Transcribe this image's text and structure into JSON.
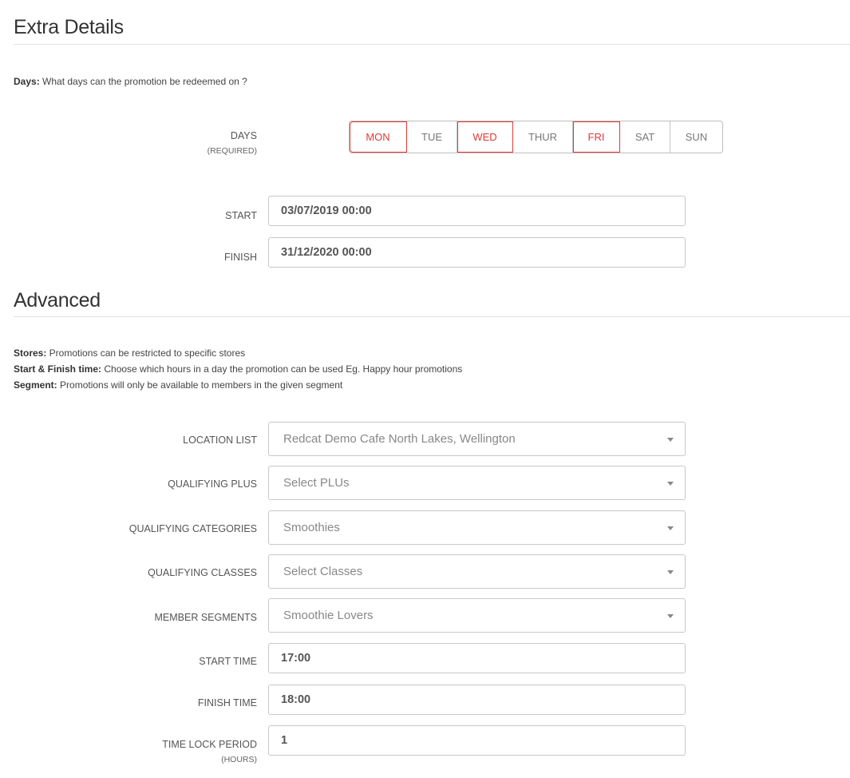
{
  "extra": {
    "title": "Extra Details",
    "help_key": "Days:",
    "help_text": " What days can the promotion be redeemed on ?",
    "days_label": "DAYS",
    "days_required": "(REQUIRED)",
    "days": [
      {
        "label": "MON",
        "selected": true
      },
      {
        "label": "TUE",
        "selected": false
      },
      {
        "label": "WED",
        "selected": true
      },
      {
        "label": "THUR",
        "selected": false
      },
      {
        "label": "FRI",
        "selected": true
      },
      {
        "label": "SAT",
        "selected": false
      },
      {
        "label": "SUN",
        "selected": false
      }
    ],
    "start_label": "START",
    "start_value": "03/07/2019 00:00",
    "finish_label": "FINISH",
    "finish_value": "31/12/2020 00:00"
  },
  "advanced": {
    "title": "Advanced",
    "help": [
      {
        "key": "Stores:",
        "text": " Promotions can be restricted to specific stores"
      },
      {
        "key": "Start & Finish time:",
        "text": " Choose which hours in a day the promotion can be used Eg. Happy hour promotions"
      },
      {
        "key": "Segment:",
        "text": " Promotions will only be available to members in the given segment"
      }
    ],
    "location_label": "LOCATION LIST",
    "location_value": "Redcat Demo Cafe North Lakes, Wellington",
    "plus_label": "QUALIFYING PLUS",
    "plus_value": "Select PLUs",
    "categories_label": "QUALIFYING CATEGORIES",
    "categories_value": "Smoothies",
    "classes_label": "QUALIFYING CLASSES",
    "classes_value": "Select Classes",
    "segments_label": "MEMBER SEGMENTS",
    "segments_value": "Smoothie Lovers",
    "start_time_label": "START TIME",
    "start_time_value": "17:00",
    "finish_time_label": "FINISH TIME",
    "finish_time_value": "18:00",
    "timelock_label": "TIME LOCK PERIOD",
    "timelock_unit": "(HOURS)",
    "timelock_value": "1"
  },
  "colors": {
    "accent": "#e53935"
  }
}
